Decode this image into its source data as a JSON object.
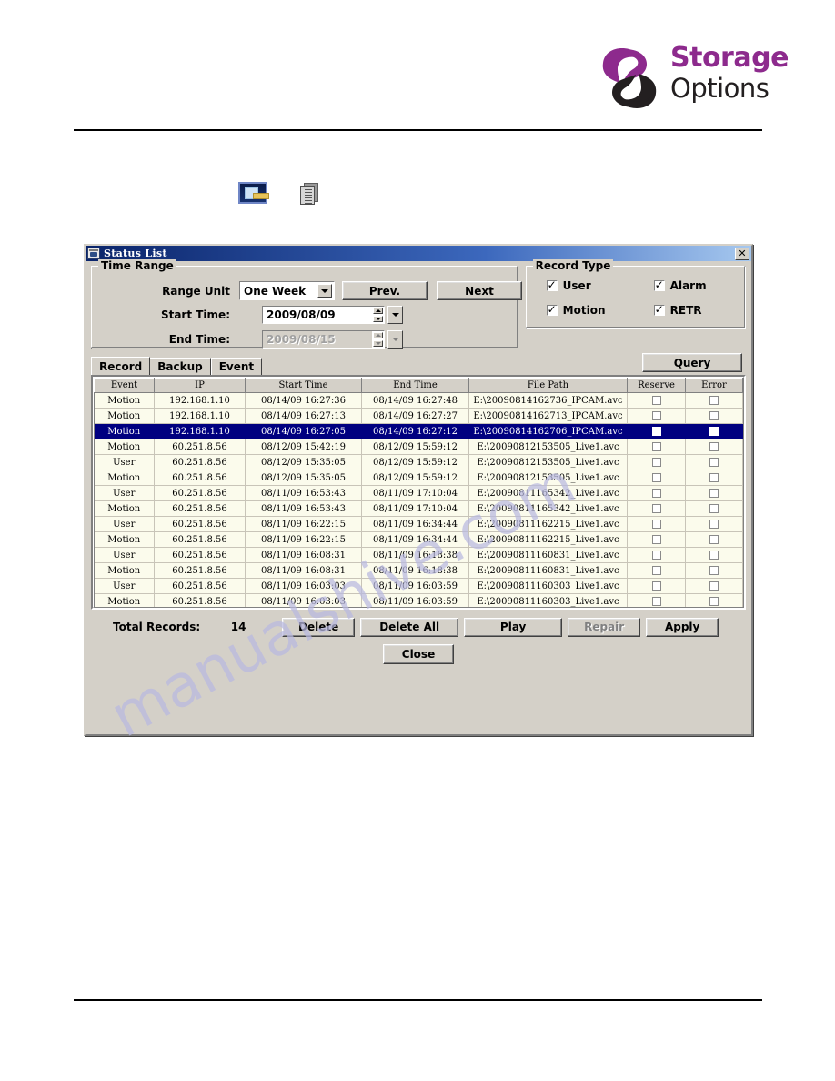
{
  "brand": {
    "name_line1": "Storage",
    "name_line2": "Options",
    "purple": "#8d2a8d",
    "black": "#231f20"
  },
  "doc_icons": [
    {
      "name": "image-thumbnail-icon"
    },
    {
      "name": "document-icon"
    }
  ],
  "watermark": {
    "text": "manualshive.com",
    "color": "#b9b9e0"
  },
  "dialog": {
    "title": "Status List",
    "close_label": "✕",
    "time_range": {
      "legend": "Time Range",
      "range_unit_label": "Range Unit",
      "range_unit_value": "One Week",
      "prev_label": "Prev.",
      "next_label": "Next",
      "start_time_label": "Start Time:",
      "start_time_value": "2009/08/09",
      "end_time_label": "End Time:",
      "end_time_value": "2009/08/15"
    },
    "record_type": {
      "legend": "Record Type",
      "options": [
        {
          "label": "User",
          "checked": true
        },
        {
          "label": "Alarm",
          "checked": true
        },
        {
          "label": "Motion",
          "checked": true
        },
        {
          "label": "RETR",
          "checked": true
        }
      ]
    },
    "tabs": [
      {
        "label": "Record",
        "active": true
      },
      {
        "label": "Backup",
        "active": false
      },
      {
        "label": "Event",
        "active": false
      }
    ],
    "query_label": "Query",
    "table": {
      "columns": [
        "Event",
        "IP",
        "Start Time",
        "End Time",
        "File Path",
        "Reserve",
        "Error"
      ],
      "selected_row_index": 2,
      "rows": [
        {
          "event": "Motion",
          "ip": "192.168.1.10",
          "start": "08/14/09 16:27:36",
          "end": "08/14/09 16:27:48",
          "path": "E:\\20090814162736_IPCAM.avc",
          "reserve": false,
          "error": false
        },
        {
          "event": "Motion",
          "ip": "192.168.1.10",
          "start": "08/14/09 16:27:13",
          "end": "08/14/09 16:27:27",
          "path": "E:\\20090814162713_IPCAM.avc",
          "reserve": false,
          "error": false
        },
        {
          "event": "Motion",
          "ip": "192.168.1.10",
          "start": "08/14/09 16:27:05",
          "end": "08/14/09 16:27:12",
          "path": "E:\\20090814162706_IPCAM.avc",
          "reserve": false,
          "error": false
        },
        {
          "event": "Motion",
          "ip": "60.251.8.56",
          "start": "08/12/09 15:42:19",
          "end": "08/12/09 15:59:12",
          "path": "E:\\20090812153505_Live1.avc",
          "reserve": false,
          "error": false
        },
        {
          "event": "User",
          "ip": "60.251.8.56",
          "start": "08/12/09 15:35:05",
          "end": "08/12/09 15:59:12",
          "path": "E:\\20090812153505_Live1.avc",
          "reserve": false,
          "error": false
        },
        {
          "event": "Motion",
          "ip": "60.251.8.56",
          "start": "08/12/09 15:35:05",
          "end": "08/12/09 15:59:12",
          "path": "E:\\20090812153505_Live1.avc",
          "reserve": false,
          "error": false
        },
        {
          "event": "User",
          "ip": "60.251.8.56",
          "start": "08/11/09 16:53:43",
          "end": "08/11/09 17:10:04",
          "path": "E:\\20090811165342_Live1.avc",
          "reserve": false,
          "error": false
        },
        {
          "event": "Motion",
          "ip": "60.251.8.56",
          "start": "08/11/09 16:53:43",
          "end": "08/11/09 17:10:04",
          "path": "E:\\20090811165342_Live1.avc",
          "reserve": false,
          "error": false
        },
        {
          "event": "User",
          "ip": "60.251.8.56",
          "start": "08/11/09 16:22:15",
          "end": "08/11/09 16:34:44",
          "path": "E:\\20090811162215_Live1.avc",
          "reserve": false,
          "error": false
        },
        {
          "event": "Motion",
          "ip": "60.251.8.56",
          "start": "08/11/09 16:22:15",
          "end": "08/11/09 16:34:44",
          "path": "E:\\20090811162215_Live1.avc",
          "reserve": false,
          "error": false
        },
        {
          "event": "User",
          "ip": "60.251.8.56",
          "start": "08/11/09 16:08:31",
          "end": "08/11/09 16:18:38",
          "path": "E:\\20090811160831_Live1.avc",
          "reserve": false,
          "error": false
        },
        {
          "event": "Motion",
          "ip": "60.251.8.56",
          "start": "08/11/09 16:08:31",
          "end": "08/11/09 16:18:38",
          "path": "E:\\20090811160831_Live1.avc",
          "reserve": false,
          "error": false
        },
        {
          "event": "User",
          "ip": "60.251.8.56",
          "start": "08/11/09 16:03:03",
          "end": "08/11/09 16:03:59",
          "path": "E:\\20090811160303_Live1.avc",
          "reserve": false,
          "error": false
        },
        {
          "event": "Motion",
          "ip": "60.251.8.56",
          "start": "08/11/09 16:03:03",
          "end": "08/11/09 16:03:59",
          "path": "E:\\20090811160303_Live1.avc",
          "reserve": false,
          "error": false
        }
      ]
    },
    "footer": {
      "total_label": "Total Records:",
      "total_value": "14",
      "delete_label": "Delete",
      "delete_all_label": "Delete All",
      "play_label": "Play",
      "repair_label": "Repair",
      "apply_label": "Apply",
      "close_label": "Close"
    }
  }
}
